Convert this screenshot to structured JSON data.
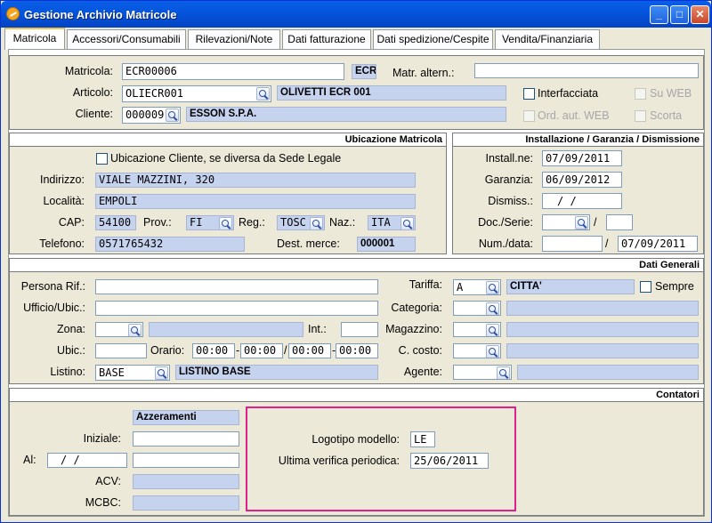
{
  "window": {
    "title": "Gestione Archivio Matricole",
    "minimize": "_",
    "maximize": "□",
    "close": "✕"
  },
  "tabs": [
    {
      "label": "Matricola"
    },
    {
      "label": "Accessori/Consumabili"
    },
    {
      "label": "Rilevazioni/Note"
    },
    {
      "label": "Dati fatturazione"
    },
    {
      "label": "Dati spedizione/Cespite"
    },
    {
      "label": "Vendita/Finanziaria"
    }
  ],
  "header": {
    "matricola_label": "Matricola:",
    "matricola": "ECR00006",
    "matricola_tag": "ECR",
    "matr_altern_label": "Matr. altern.:",
    "matr_altern": "",
    "articolo_label": "Articolo:",
    "articolo": "OLIECR001",
    "articolo_desc": "OLIVETTI ECR 001",
    "cliente_label": "Cliente:",
    "cliente": "000009",
    "cliente_desc": "ESSON S.P.A.",
    "interfacciata": "Interfacciata",
    "su_web": "Su WEB",
    "ord_aut_web": "Ord. aut. WEB",
    "scorta": "Scorta"
  },
  "ubicazione": {
    "title": "Ubicazione Matricola",
    "diversa": "Ubicazione Cliente, se diversa da Sede Legale",
    "indirizzo_label": "Indirizzo:",
    "indirizzo": "VIALE MAZZINI, 320",
    "localita_label": "Località:",
    "localita": "EMPOLI",
    "cap_label": "CAP:",
    "cap": "54100",
    "prov_label": "Prov.:",
    "prov": "FI",
    "reg_label": "Reg.:",
    "reg": "TOSC",
    "naz_label": "Naz.:",
    "naz": "ITA",
    "telefono_label": "Telefono:",
    "telefono": "0571765432",
    "dest_label": "Dest. merce:",
    "dest": "000001"
  },
  "installazione": {
    "title": "Installazione / Garanzia / Dismissione",
    "install_label": "Install.ne:",
    "install": "07/09/2011",
    "garanzia_label": "Garanzia:",
    "garanzia": "06/09/2012",
    "dismiss_label": "Dismiss.:",
    "dismiss": "/ /",
    "doc_label": "Doc./Serie:",
    "doc_sep": "/",
    "num_label": "Num./data:",
    "num_sep": "/",
    "num_data": "07/09/2011"
  },
  "generali": {
    "title": "Dati Generali",
    "persona_label": "Persona Rif.:",
    "ufficio_label": "Ufficio/Ubic.:",
    "zona_label": "Zona:",
    "int_label": "Int.:",
    "ubic_label": "Ubic.:",
    "orario_label": "Orario:",
    "orario": [
      "00:00",
      "00:00",
      "00:00",
      "00:00"
    ],
    "orario_dash": "-",
    "orario_slash": "/",
    "listino_label": "Listino:",
    "listino": "BASE",
    "listino_desc": "LISTINO BASE",
    "tariffa_label": "Tariffa:",
    "tariffa": "A",
    "tariffa_desc": "CITTA'",
    "sempre": "Sempre",
    "categoria_label": "Categoria:",
    "magazzino_label": "Magazzino:",
    "ccosto_label": "C. costo:",
    "agente_label": "Agente:"
  },
  "contatori": {
    "title": "Contatori",
    "azzeramenti": "Azzeramenti",
    "iniziale_label": "Iniziale:",
    "al_label": "Al:",
    "al_date": "/ /",
    "acv_label": "ACV:",
    "mcbc_label": "MCBC:",
    "logotipo_label": "Logotipo modello:",
    "logotipo": "LE",
    "verifica_label": "Ultima verifica periodica:",
    "verifica": "25/06/2011"
  }
}
